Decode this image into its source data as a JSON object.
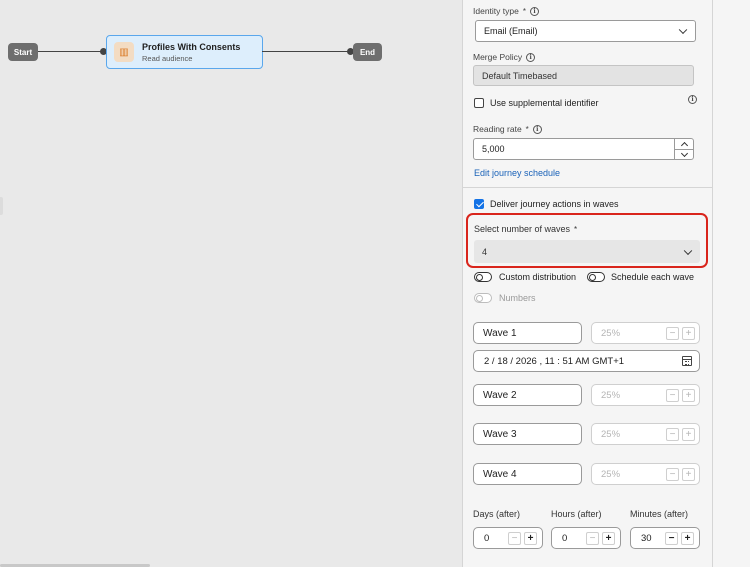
{
  "canvas": {
    "start_label": "Start",
    "end_label": "End",
    "audience_node": {
      "title": "Profiles With Consents",
      "subtitle": "Read audience",
      "icon": "audience-icon"
    }
  },
  "panel": {
    "identity_type": {
      "label": "Identity type",
      "required_mark": "*",
      "value": "Email (Email)"
    },
    "merge_policy": {
      "label": "Merge Policy",
      "value": "Default Timebased"
    },
    "supplemental": {
      "label": "Use supplemental identifier",
      "checked": false
    },
    "reading_rate": {
      "label": "Reading rate",
      "required_mark": "*",
      "value": "5,000"
    },
    "edit_schedule_link": "Edit journey schedule",
    "deliver_waves": {
      "label": "Deliver journey actions in waves",
      "checked": true
    },
    "waves_count": {
      "label": "Select number of waves",
      "required_mark": "*",
      "value": "4"
    },
    "toggles": {
      "custom_distribution": "Custom distribution",
      "schedule_each_wave": "Schedule each wave",
      "numbers": "Numbers"
    },
    "waves": [
      {
        "name": "Wave 1",
        "percent": "25%"
      },
      {
        "name": "Wave 2",
        "percent": "25%"
      },
      {
        "name": "Wave 3",
        "percent": "25%"
      },
      {
        "name": "Wave 4",
        "percent": "25%"
      }
    ],
    "wave1_datetime": "2 / 18 / 2026 ,  11 : 51   AM   GMT+1",
    "offsets": {
      "days": {
        "label": "Days (after)",
        "value": "0"
      },
      "hours": {
        "label": "Hours (after)",
        "value": "0"
      },
      "minutes": {
        "label": "Minutes (after)",
        "value": "30"
      }
    },
    "minus_glyph": "−",
    "plus_glyph": "+"
  },
  "colors": {
    "accent": "#1473e6",
    "highlight": "#d9251c",
    "node_selected_border": "#5aa7ec",
    "link": "#1a62b8"
  }
}
